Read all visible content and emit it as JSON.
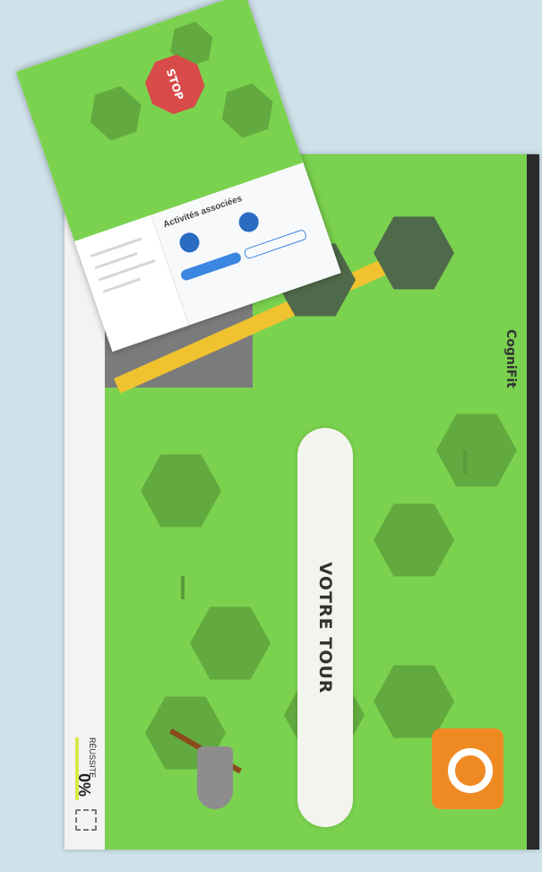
{
  "game": {
    "turn_label": "VOTRE TOUR",
    "score_label": "RÉUSSITE",
    "score_value": "0%",
    "logo": "CogniFit"
  },
  "overlay": {
    "stop_sign": "STOP",
    "panel_title": "Activités associées"
  },
  "icons": {
    "fullscreen": "fullscreen-icon"
  },
  "colors": {
    "grass": "#7ad24e",
    "road": "#7b7b7b",
    "stripe": "#f0c230",
    "accent_blue": "#3b86e0",
    "stop_red": "#d94a4a"
  }
}
